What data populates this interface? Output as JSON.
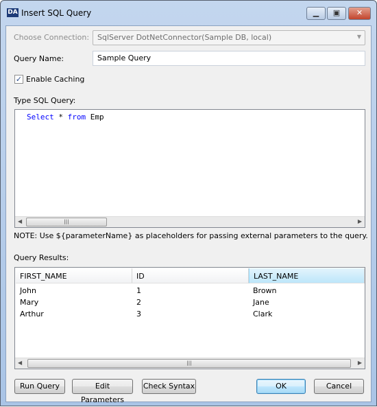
{
  "window": {
    "title": "Insert SQL Query",
    "logo": "DA"
  },
  "form": {
    "connection_label": "Choose Connection:",
    "connection_value": "SqlServer DotNetConnector(Sample DB, local)",
    "query_name_label": "Query Name:",
    "query_name_value": "Sample Query",
    "enable_caching_label": "Enable Caching",
    "enable_caching_checked": true,
    "sql_label": "Type SQL Query:",
    "sql": {
      "kw1": "Select",
      "mid": " * ",
      "kw2": "from",
      "rest": " Emp"
    },
    "note": "NOTE: Use ${parameterName} as placeholders for passing external parameters to the query.",
    "results_label": "Query Results:"
  },
  "results": {
    "columns": [
      "FIRST_NAME",
      "ID",
      "LAST_NAME"
    ],
    "rows": [
      [
        "John",
        "1",
        "Brown"
      ],
      [
        "Mary",
        "2",
        "Jane"
      ],
      [
        "Arthur",
        "3",
        "Clark"
      ]
    ]
  },
  "buttons": {
    "run": "Run Query",
    "edit": "Edit Parameters",
    "check": "Check Syntax",
    "ok": "OK",
    "cancel": "Cancel"
  }
}
